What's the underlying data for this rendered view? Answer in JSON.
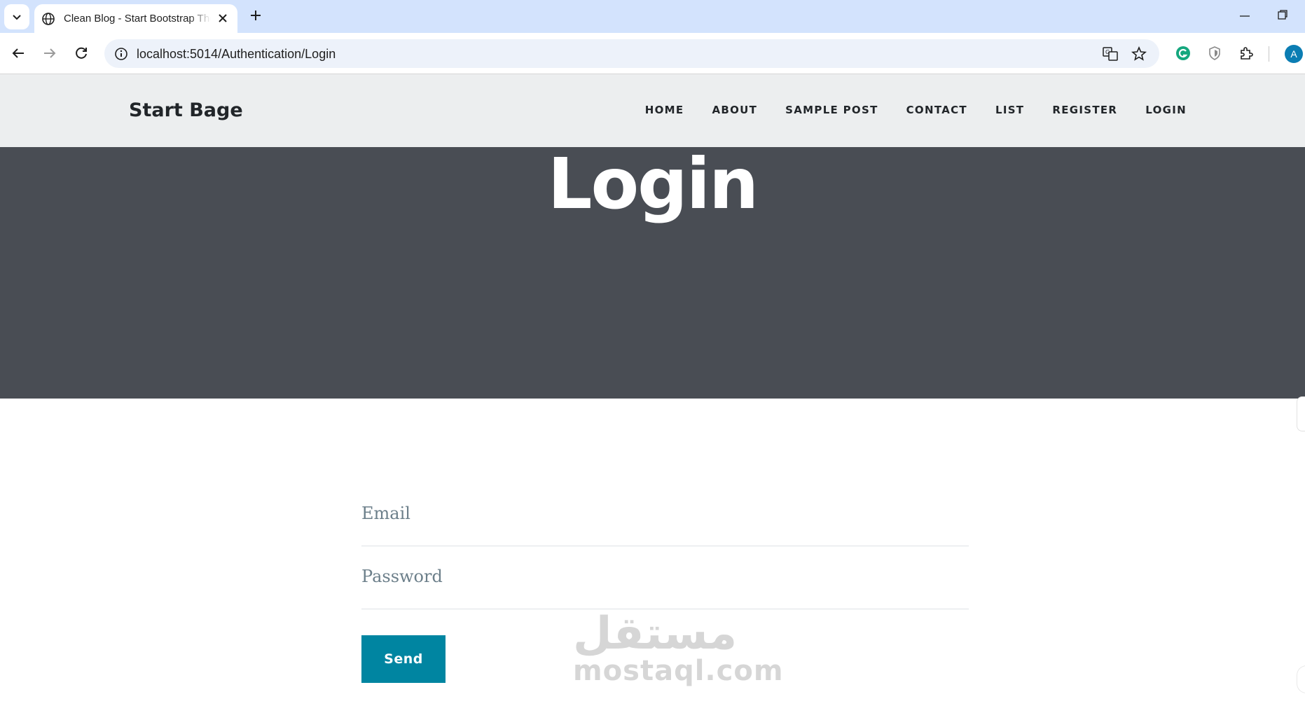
{
  "browser": {
    "tab_title": "Clean Blog - Start Bootstrap Theme",
    "url": "localhost:5014/Authentication/Login",
    "profile_initial": "A"
  },
  "navbar": {
    "brand": "Start Bage",
    "links": [
      "HOME",
      "ABOUT",
      "SAMPLE POST",
      "CONTACT",
      "LIST",
      "REGISTER",
      "LOGIN"
    ]
  },
  "hero": {
    "title": "Login"
  },
  "form": {
    "email_placeholder": "Email",
    "password_placeholder": "Password",
    "send_label": "Send"
  },
  "watermark": {
    "arabic": "مستقل",
    "latin": "mostaql.com"
  },
  "colors": {
    "tabstrip": "#d3e3fd",
    "navbar_bg": "#eceeef",
    "hero_bg": "#494d54",
    "button_bg": "#0085a1"
  }
}
